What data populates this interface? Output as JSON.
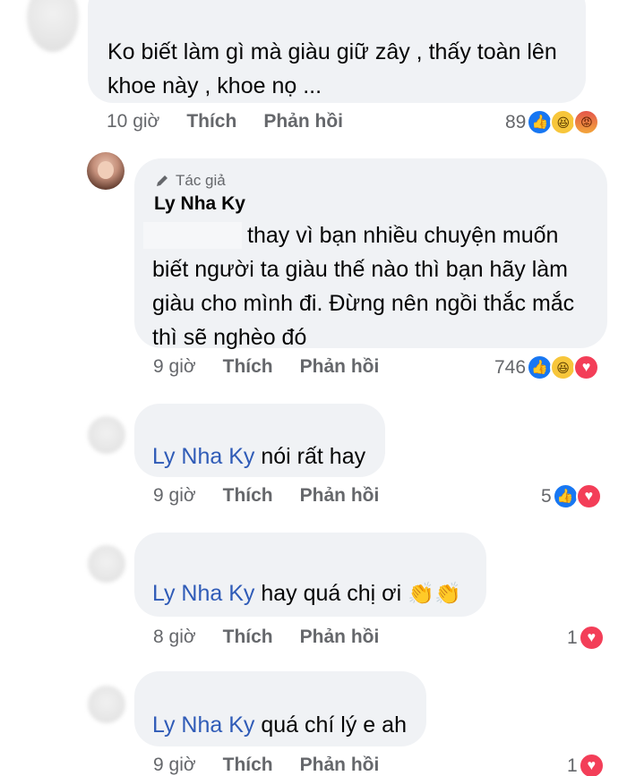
{
  "comments": [
    {
      "text_line1": "Ko biết làm gì mà giàu giữ zây , thấy toàn lên",
      "text_line2": "khoe này , khoe nọ ...",
      "time": "10 giờ",
      "like_label": "Thích",
      "reply_label": "Phản hồi",
      "reaction_count": "89",
      "reactions": [
        "like-icon",
        "haha-icon",
        "angry-icon"
      ]
    },
    {
      "badge": "Tác giả",
      "author": "Ly Nha Ky",
      "text_line1": "thay vì bạn nhiều chuyện muốn",
      "text_line2": "biết người ta giàu thế nào thì bạn hãy làm",
      "text_line3": "giàu cho mình đi. Đừng nên ngồi thắc mắc",
      "text_line4": "thì sẽ nghèo đó",
      "time": "9 giờ",
      "like_label": "Thích",
      "reply_label": "Phản hồi",
      "reaction_count": "746",
      "reactions": [
        "like-icon",
        "haha-icon",
        "love-icon"
      ]
    },
    {
      "mention": "Ly Nha Ky",
      "text": "nói rất hay",
      "time": "9 giờ",
      "like_label": "Thích",
      "reply_label": "Phản hồi",
      "reaction_count": "5",
      "reactions": [
        "like-icon",
        "love-icon"
      ]
    },
    {
      "mention": "Ly Nha Ky",
      "text": "hay quá chị ơi",
      "emoji": "👏👏",
      "time": "8 giờ",
      "like_label": "Thích",
      "reply_label": "Phản hồi",
      "reaction_count": "1",
      "reactions": [
        "love-icon"
      ]
    },
    {
      "mention": "Ly Nha Ky",
      "text": "quá chí lý e ah",
      "time": "9 giờ",
      "like_label": "Thích",
      "reply_label": "Phản hồi",
      "reaction_count": "1",
      "reactions": [
        "love-icon"
      ]
    }
  ],
  "colors": {
    "bubble": "#f0f2f5",
    "meta": "#65676b",
    "mention": "#2f5bb7",
    "like": "#1877f2",
    "love": "#f33e58"
  }
}
